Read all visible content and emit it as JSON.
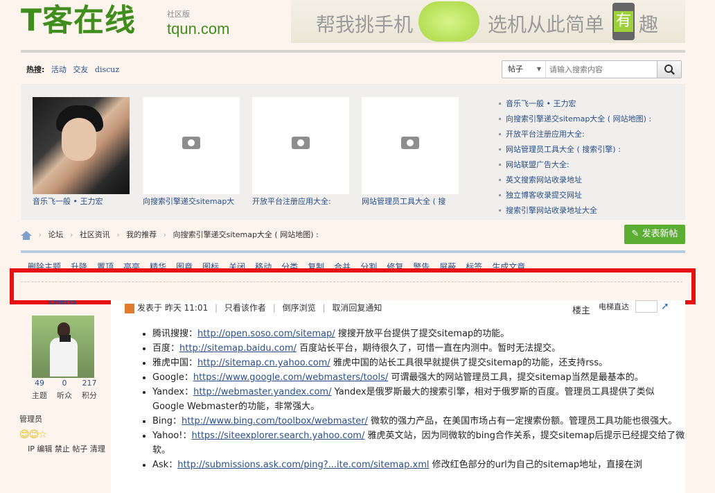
{
  "logo": {
    "name": "T客在线",
    "sub": "社区版",
    "domain": "tqun.com"
  },
  "banner": {
    "left_text": "帮我挑手机",
    "right_text": "选机从此简单",
    "highlight": "有",
    "end": "趣"
  },
  "hot": {
    "label": "热搜:",
    "items": [
      "活动",
      "交友",
      "discuz"
    ]
  },
  "search": {
    "scope": "帖子",
    "placeholder": "请输入搜索内容"
  },
  "featured": {
    "captions": [
      "音乐飞一般 • 王力宏",
      "向搜索引擎递交sitemap大",
      "开放平台注册应用大全:",
      "网站管理员工具大全 ( 搜"
    ],
    "links": [
      "音乐飞一般 • 王力宏",
      "向搜索引擎递交sitemap大全 ( 网站地图) :",
      "开放平台注册应用大全:",
      "网站管理员工具大全 ( 搜索引擎) :",
      "网站联盟广告大全:",
      "英文搜索网站收录地址",
      "独立博客收录提交网址",
      "搜索引擎网站收录地址大全"
    ]
  },
  "breadcrumb": [
    "论坛",
    "社区资讯",
    "我的推荐",
    "向搜索引擎递交sitemap大全 ( 网站地图) :"
  ],
  "new_post": "发表新帖",
  "modbar": [
    "删除主题",
    "升降",
    "置顶",
    "高亮",
    "精华",
    "图章",
    "图标",
    "关闭",
    "移动",
    "分类",
    "复制",
    "合并",
    "分割",
    "修复",
    "警告",
    "屏蔽",
    "标签",
    "生成文章"
  ],
  "author": {
    "name": "cheris",
    "stats": [
      {
        "n": "49",
        "label": "主题"
      },
      {
        "n": "0",
        "label": "听众"
      },
      {
        "n": "217",
        "label": "积分"
      }
    ],
    "role": "管理员",
    "stars": "😊😊☆",
    "mod_links": "IP 编辑 禁止 帖子 清理"
  },
  "post_head": {
    "posted": "发表于 昨天 11:01",
    "only_author": "只看该作者",
    "reverse": "倒序浏览",
    "cancel_notify": "取消回复通知",
    "louzhu": "楼主",
    "jump": "电梯直达"
  },
  "entries": [
    {
      "name": "腾讯搜搜：",
      "url": "http://open.soso.com/sitemap/",
      "desc": " 搜搜开放平台提供了提交sitemap的功能。"
    },
    {
      "name": "百度：",
      "url": "http://sitemap.baidu.com/",
      "desc": " 百度站长平台，期待很久了，可惜一直在内测中。暂时无法提交。"
    },
    {
      "name": "雅虎中国：",
      "url": "http://sitemap.cn.yahoo.com/",
      "desc": " 雅虎中国的站长工具很早就提供了提交sitemap的功能，还支持rss。"
    },
    {
      "name": "Google：",
      "url": "https://www.google.com/webmasters/tools/",
      "desc": " 可谓最强大的网站管理员工具，提交sitemap当然是最基本的。"
    },
    {
      "name": "Yandex：",
      "url": "http://webmaster.yandex.com/",
      "desc": " Yandex是俄罗斯最大的搜索引擎，相对于俄罗斯的百度。管理员工具提供了类似Google Webmaster的功能，非常强大。"
    },
    {
      "name": "Bing：",
      "url": "http://www.bing.com/toolbox/webmaster/",
      "desc": " 微软的强力产品，在美国市场占有一定搜索份额。管理员工具功能也很强大。"
    },
    {
      "name": "Yahoo!：",
      "url": "https://siteexplorer.search.yahoo.com/",
      "desc": " 雅虎英文站，因为同微软的bing合作关系，提交sitemap后提示已经提交给了微软。"
    },
    {
      "name": "Ask：",
      "url": "http://submissions.ask.com/ping?...ite.com/sitemap.xml",
      "desc": " 修改红色部分的url为自己的sitemap地址，直接在浏"
    }
  ]
}
